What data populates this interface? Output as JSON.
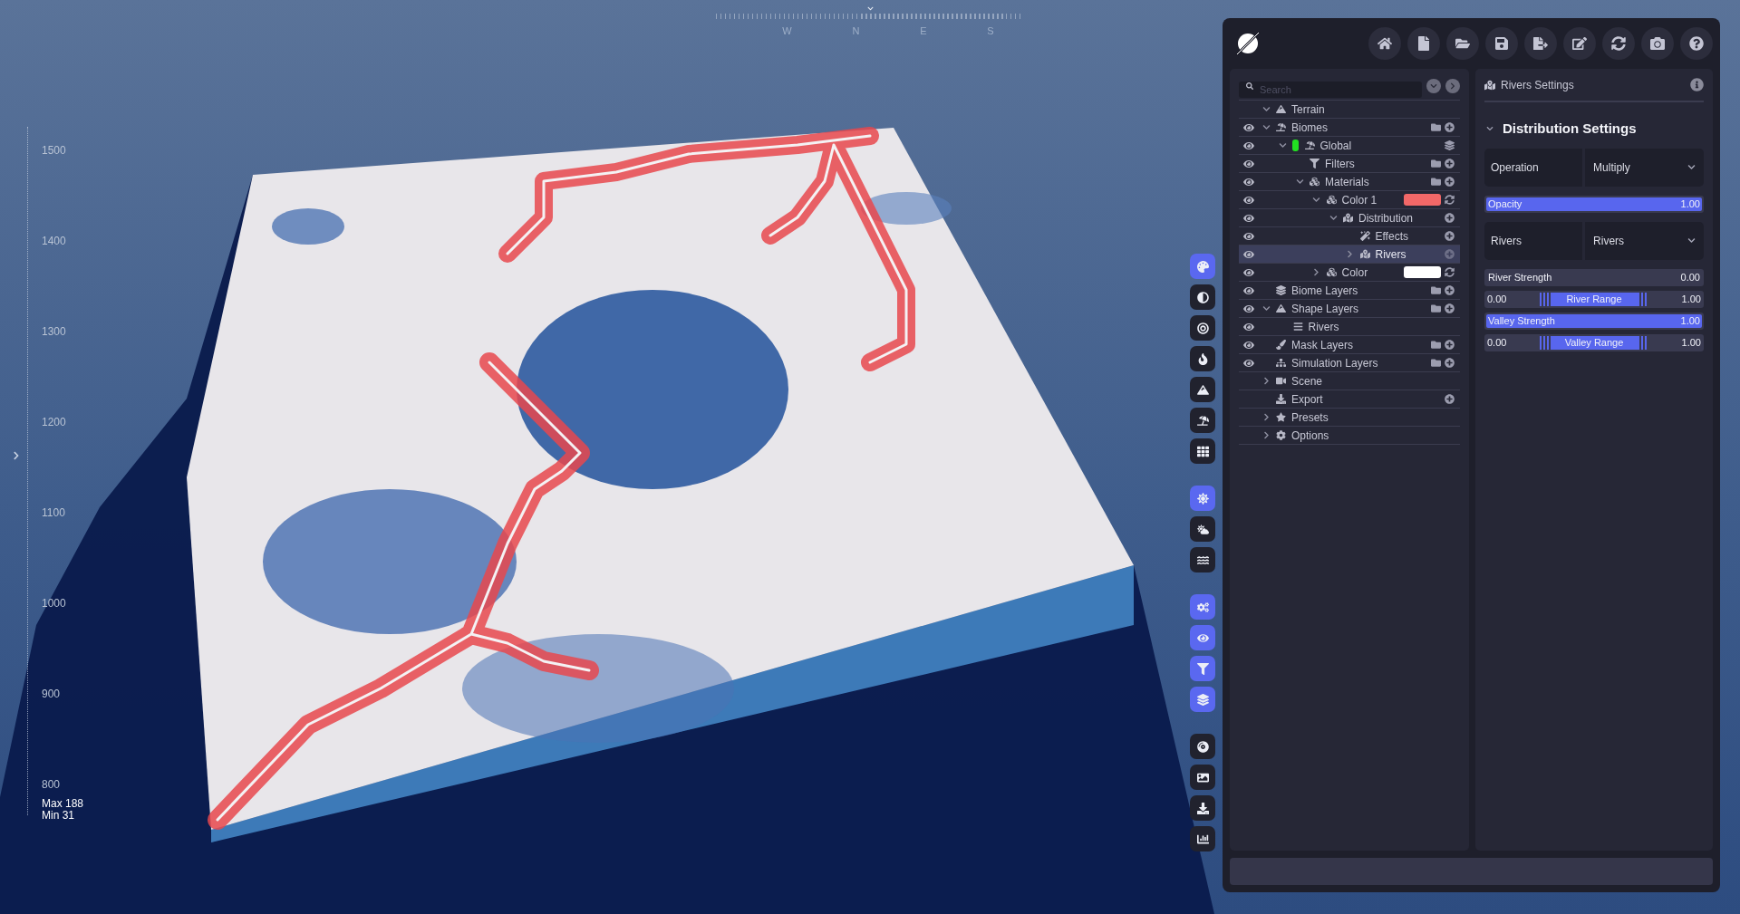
{
  "viewport": {
    "compass": {
      "labels": [
        "W",
        "N",
        "E",
        "S"
      ]
    },
    "elevation_axis": {
      "labels": [
        "1500",
        "1400",
        "1300",
        "1200",
        "1100",
        "1000",
        "900",
        "800"
      ],
      "max": "Max 188",
      "min": "Min 31"
    }
  },
  "tool_strip": [
    {
      "tools": [
        {
          "selected": true
        },
        {
          "selected": false
        },
        {
          "selected": false
        },
        {
          "selected": false
        },
        {
          "selected": false
        },
        {
          "selected": false
        },
        {
          "selected": false
        }
      ]
    },
    {
      "tools": [
        {
          "selected": true
        },
        {
          "selected": false
        },
        {
          "selected": false
        }
      ]
    },
    {
      "tools": [
        {
          "selected": true
        },
        {
          "selected": true
        },
        {
          "selected": true
        },
        {
          "selected": true
        }
      ]
    },
    {
      "tools": [
        {
          "selected": false
        },
        {
          "selected": false
        },
        {
          "selected": false
        },
        {
          "selected": false
        }
      ]
    }
  ],
  "search": {
    "placeholder": "Search"
  },
  "tree": [
    {
      "label": "Terrain",
      "kind": "terrain",
      "eye": false,
      "expanded": true,
      "selected": false,
      "children": [
        {
          "label": "Biomes",
          "kind": "biomes",
          "eye": true,
          "expanded": true,
          "selected": false,
          "actions": [
            {
              "kind": "folder"
            },
            {
              "kind": "add"
            }
          ],
          "children": [
            {
              "label": "Global",
              "kind": "global",
              "eye": true,
              "expanded": true,
              "selected": false,
              "color": "#22e022",
              "actions": [
                {
                  "kind": "stack"
                }
              ],
              "children": [
                {
                  "label": "Filters",
                  "kind": "filter",
                  "eye": true,
                  "selected": false,
                  "actions": [
                    {
                      "kind": "folder"
                    },
                    {
                      "kind": "add"
                    }
                  ]
                },
                {
                  "label": "Materials",
                  "kind": "material",
                  "eye": true,
                  "expanded": true,
                  "selected": false,
                  "actions": [
                    {
                      "kind": "folder"
                    },
                    {
                      "kind": "add"
                    }
                  ],
                  "children": [
                    {
                      "label": "Color 1",
                      "kind": "material",
                      "eye": true,
                      "expanded": true,
                      "selected": false,
                      "color": "#f26868",
                      "actions": [
                        {
                          "kind": "refresh"
                        }
                      ],
                      "children": [
                        {
                          "label": "Distribution",
                          "kind": "distribution",
                          "eye": true,
                          "expanded": true,
                          "selected": false,
                          "actions": [
                            {
                              "kind": "add"
                            }
                          ],
                          "children": [
                            {
                              "label": "Effects",
                              "kind": "effects",
                              "eye": true,
                              "selected": false,
                              "actions": [
                                {
                                  "kind": "add"
                                }
                              ]
                            },
                            {
                              "label": "Rivers",
                              "kind": "distribution",
                              "eye": true,
                              "expanded": false,
                              "selected": true,
                              "actions": [
                                {
                                  "kind": "add"
                                }
                              ]
                            }
                          ]
                        }
                      ]
                    },
                    {
                      "label": "Color",
                      "kind": "material",
                      "eye": true,
                      "expanded": false,
                      "selected": false,
                      "color": "#ffffff",
                      "actions": [
                        {
                          "kind": "refresh"
                        }
                      ]
                    }
                  ]
                }
              ]
            }
          ]
        },
        {
          "label": "Biome Layers",
          "kind": "layers",
          "eye": true,
          "selected": false,
          "actions": [
            {
              "kind": "folder"
            },
            {
              "kind": "add"
            }
          ]
        },
        {
          "label": "Shape Layers",
          "kind": "shape",
          "eye": true,
          "expanded": true,
          "selected": false,
          "actions": [
            {
              "kind": "folder"
            },
            {
              "kind": "add"
            }
          ],
          "children": [
            {
              "label": "Rivers",
              "kind": "river",
              "eye": true,
              "selected": false
            }
          ]
        },
        {
          "label": "Mask Layers",
          "kind": "brush",
          "eye": true,
          "selected": false,
          "actions": [
            {
              "kind": "folder"
            },
            {
              "kind": "add"
            }
          ]
        },
        {
          "label": "Simulation Layers",
          "kind": "simulation",
          "eye": true,
          "selected": false,
          "actions": [
            {
              "kind": "folder"
            },
            {
              "kind": "add"
            }
          ]
        }
      ]
    },
    {
      "label": "Scene",
      "kind": "scene",
      "eye": false,
      "expanded": false,
      "selected": false
    },
    {
      "label": "Export",
      "kind": "export",
      "eye": false,
      "selected": false,
      "actions": [
        {
          "kind": "add"
        }
      ]
    },
    {
      "label": "Presets",
      "kind": "presets",
      "eye": false,
      "expanded": false,
      "selected": false
    },
    {
      "label": "Options",
      "kind": "options",
      "eye": false,
      "expanded": false,
      "selected": false
    }
  ],
  "settings": {
    "title": "Rivers Settings",
    "section": {
      "title": "Distribution Settings",
      "expanded": true
    },
    "controls": [
      {
        "kind": "dropdown",
        "label": "Operation",
        "value": "Multiply"
      },
      {
        "kind": "slider",
        "label": "Opacity",
        "value": "1.00",
        "level": 1
      },
      {
        "kind": "dropdown",
        "label": "Rivers",
        "value": "Rivers"
      },
      {
        "kind": "slider",
        "label": "River Strength",
        "value": "0.00",
        "level": 0
      },
      {
        "kind": "range",
        "label": "River Range",
        "min": "0.00",
        "max": "1.00",
        "level": 1
      },
      {
        "kind": "slider",
        "label": "Valley Strength",
        "value": "1.00",
        "level": 1
      },
      {
        "kind": "range",
        "label": "Valley Range",
        "min": "0.00",
        "max": "1.00",
        "level": 1
      }
    ]
  }
}
